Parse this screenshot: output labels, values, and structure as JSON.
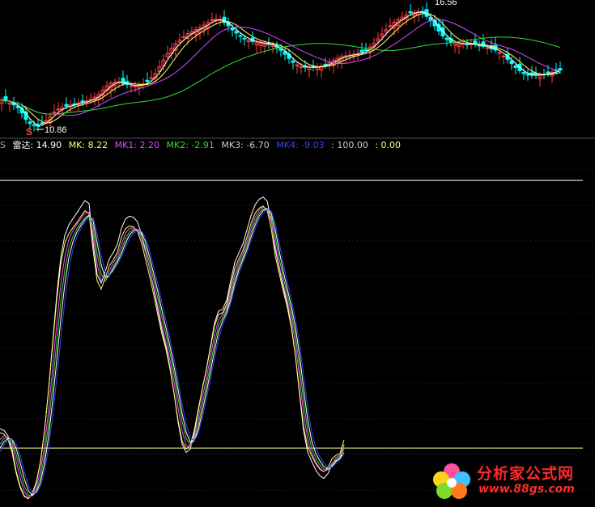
{
  "colors": {
    "background": "#000000",
    "candle_up": "#ff4040",
    "candle_down": "#00ffff",
    "ma_white": "#ffffff",
    "ma_yellow": "#ffff66",
    "ma_magenta": "#d24dff",
    "ma_green": "#33dd33",
    "osc_white": "#ffffff",
    "osc_yellow": "#ffff66",
    "osc_magenta": "#ff44ff",
    "osc_green": "#33dd33",
    "osc_blue": "#3344ff",
    "guide_line": "#ffffff",
    "low_guide": "#ffff88"
  },
  "price_panel": {
    "high_label": "16.56",
    "low_label": "10.86",
    "marker_icon": "S"
  },
  "indicator_legend": {
    "left_glyph": "S",
    "items": [
      {
        "label": "雷达: 14.90",
        "color": "#ffffff"
      },
      {
        "label": "MK: 8.22",
        "color": "#ffff66"
      },
      {
        "label": "MK1: 2.20",
        "color": "#d24dff"
      },
      {
        "label": "MK2: -2.91",
        "color": "#33dd33"
      },
      {
        "label": "MK3: -6.70",
        "color": "#cccccc"
      },
      {
        "label": "MK4: -9.03",
        "color": "#3344ff"
      },
      {
        "label": ": 100.00",
        "color": "#cccccc"
      },
      {
        "label": ": 0.00",
        "color": "#ffff88"
      }
    ]
  },
  "watermark": {
    "chinese": "分析家公式网",
    "url": "www.88gs.com"
  },
  "chart_data": [
    {
      "type": "candlestick",
      "title": "",
      "ylim": [
        10.5,
        16.8
      ],
      "x": [
        0,
        5,
        10,
        15,
        20,
        25,
        30,
        35,
        40,
        45,
        50,
        55,
        60,
        65,
        70,
        75,
        80,
        85,
        90,
        95,
        100,
        105,
        110,
        115,
        120,
        125,
        130,
        135,
        140,
        145,
        150,
        155,
        160,
        165,
        170,
        175,
        180,
        185,
        190,
        195,
        200,
        205,
        210,
        215,
        220,
        225,
        230,
        235,
        240,
        245,
        250,
        255,
        260,
        265,
        270,
        275,
        280,
        285,
        290,
        295,
        300,
        305,
        310,
        315,
        320,
        325,
        330,
        335,
        340,
        345,
        350,
        355,
        360,
        365,
        370,
        375,
        380,
        385,
        390,
        395,
        400,
        405,
        410,
        415,
        420,
        425,
        430,
        435,
        440,
        445,
        450,
        455,
        460,
        465,
        470,
        475,
        480,
        485,
        490,
        495,
        500,
        505,
        510,
        515,
        520,
        525,
        530,
        535,
        540,
        545,
        550,
        555,
        560,
        565,
        570,
        575,
        580,
        585,
        590,
        595,
        600,
        605,
        610,
        615,
        620,
        625,
        630,
        635,
        640,
        645,
        650,
        655,
        660,
        665,
        670,
        675,
        680,
        685,
        690,
        695,
        700,
        705,
        710,
        715,
        720
      ],
      "close": [
        12.19,
        12.14,
        12.05,
        11.95,
        11.82,
        11.58,
        11.27,
        11.08,
        11.0,
        10.94,
        11.09,
        11.22,
        11.42,
        11.62,
        11.76,
        11.82,
        11.89,
        11.95,
        11.99,
        12.05,
        12.08,
        12.14,
        12.21,
        12.32,
        12.45,
        12.65,
        12.84,
        12.97,
        13.03,
        13.03,
        12.97,
        12.91,
        12.85,
        12.84,
        12.88,
        12.94,
        13.05,
        13.23,
        13.43,
        13.74,
        14.06,
        14.37,
        14.62,
        14.82,
        15.0,
        15.15,
        15.3,
        15.39,
        15.49,
        15.58,
        15.7,
        15.82,
        15.95,
        15.97,
        15.94,
        15.82,
        15.66,
        15.47,
        15.32,
        15.2,
        15.06,
        14.98,
        14.93,
        14.89,
        14.86,
        14.82,
        14.79,
        14.75,
        14.65,
        14.51,
        14.33,
        14.13,
        13.95,
        13.83,
        13.75,
        13.72,
        13.71,
        13.72,
        13.74,
        13.78,
        13.84,
        13.93,
        14.05,
        14.14,
        14.22,
        14.26,
        14.29,
        14.33,
        14.37,
        14.43,
        14.53,
        14.67,
        14.85,
        15.06,
        15.28,
        15.48,
        15.67,
        15.83,
        15.95,
        16.07,
        16.18,
        16.27,
        16.3,
        16.34,
        16.29,
        16.11,
        15.9,
        15.66,
        15.42,
        15.19,
        15.02,
        14.91,
        14.86,
        14.83,
        14.83,
        14.81,
        14.81,
        14.79,
        14.74,
        14.7,
        14.64,
        14.58,
        14.52,
        14.4,
        14.25,
        14.09,
        13.89,
        13.71,
        13.56,
        13.42,
        13.35,
        13.34,
        13.35,
        13.37,
        13.39,
        13.44,
        13.49,
        13.55,
        13.59
      ]
    },
    {
      "type": "line",
      "title": "",
      "xlabel": "",
      "ylabel": "",
      "ylim": [
        -22,
        110
      ],
      "reference_lines": [
        100,
        0
      ],
      "x": [
        0,
        5,
        10,
        15,
        20,
        25,
        30,
        35,
        40,
        45,
        50,
        55,
        60,
        65,
        70,
        75,
        80,
        85,
        90,
        95,
        100,
        105,
        110,
        115,
        120,
        125,
        130,
        135,
        140,
        145,
        150,
        155,
        160,
        165,
        170,
        175,
        180,
        185,
        190,
        195,
        200,
        205,
        210,
        215,
        220,
        225,
        230,
        235,
        240,
        245,
        250,
        255,
        260,
        265,
        270,
        275,
        280,
        285,
        290,
        295,
        300,
        305,
        310,
        315,
        320,
        325,
        330,
        335,
        340,
        345,
        350,
        355,
        360,
        365,
        370,
        375,
        380,
        385,
        390,
        395,
        400,
        405,
        410,
        415,
        420,
        425,
        430,
        435,
        440,
        445,
        450,
        455,
        460,
        465,
        470,
        475,
        480,
        485,
        490,
        495,
        500,
        505,
        510,
        515,
        520,
        525,
        530,
        535,
        540,
        545,
        550,
        555,
        560,
        565,
        570,
        575,
        580,
        585,
        590,
        595,
        600,
        605,
        610,
        615,
        620,
        625,
        630,
        635,
        640,
        645,
        650,
        655,
        660,
        665,
        670,
        675,
        680,
        685,
        690,
        695,
        700,
        705,
        710,
        715,
        720
      ],
      "series": [
        {
          "name": "雷达",
          "values": [
            7.23,
            6.59,
            4.47,
            -0.62,
            -8.62,
            -14.33,
            -17.83,
            -18.91,
            -16.96,
            -12.77,
            -5.32,
            6.48,
            21.93,
            39.47,
            56.81,
            71.04,
            79.4,
            83.4,
            85.72,
            87.85,
            90.26,
            92.45,
            91.33,
            76.83,
            64.81,
            61.66,
            66.07,
            70.64,
            73.12,
            76.17,
            82.13,
            85.59,
            86.66,
            86.24,
            84.43,
            79.64,
            73.08,
            66.6,
            59.39,
            51.6,
            44.08,
            38.0,
            30.15,
            20.44,
            9.62,
            1.4,
            -1.62,
            -0.33,
            5.66,
            14.07,
            22.21,
            29.61,
            38.04,
            46.74,
            51.28,
            51.91,
            55.26,
            62.53,
            69.33,
            72.87,
            76.24,
            81.46,
            86.79,
            90.86,
            92.9,
            93.76,
            92.23,
            85.16,
            74.2,
            67.02,
            60.05,
            53.6,
            45.44,
            34.33,
            20.17,
            6.49,
            -1.47,
            -4.89,
            -8.15,
            -10.31,
            -11.34,
            -9.55,
            -6.24,
            -4.76,
            -4.05,
            1.31
          ]
        },
        {
          "name": "MK",
          "values": [
            5.8,
            5.2,
            3.2,
            -1.7,
            -9.4,
            -14.8,
            -18.1,
            -18.9,
            -16.8,
            -12.4,
            -5.0,
            6.7,
            21.6,
            38.6,
            55.2,
            68.6,
            76.5,
            80.1,
            82.3,
            84.3,
            86.6,
            88.7,
            87.6,
            73.9,
            62.5,
            59.4,
            63.6,
            68.0,
            70.3,
            73.2,
            78.8,
            82.0,
            83.0,
            82.6,
            80.9,
            76.4,
            70.2,
            64.0,
            57.1,
            49.7,
            42.6,
            36.9,
            29.5,
            20.4,
            10.3,
            2.6,
            -0.3,
            1.0,
            6.7,
            14.7,
            22.4,
            29.4,
            37.4,
            45.7,
            50.0,
            50.6,
            53.8,
            60.7,
            67.2,
            70.6,
            73.8,
            78.8,
            83.8,
            87.7,
            89.6,
            90.4,
            88.9,
            82.2,
            71.9,
            65.1,
            58.5,
            52.5,
            44.7,
            34.3,
            20.9,
            8.0,
            0.5,
            -2.8,
            -5.8,
            -7.9,
            -8.9,
            -7.2,
            -4.1,
            -2.7,
            -2.0,
            3.0
          ]
        },
        {
          "name": "MK1",
          "values": [
            3.2,
            4.6,
            3.9,
            1.2,
            -4.9,
            -11.2,
            -16.3,
            -18.4,
            -17.6,
            -14.3,
            -8.6,
            0.8,
            14.1,
            29.9,
            46.3,
            61.0,
            71.5,
            77.8,
            81.2,
            83.6,
            85.7,
            87.8,
            88.1,
            80.2,
            68.7,
            62.4,
            62.3,
            66.1,
            69.2,
            71.7,
            76.1,
            80.3,
            82.1,
            82.3,
            81.4,
            78.2,
            72.7,
            66.6,
            60.2,
            52.9,
            45.7,
            39.5,
            32.7,
            24.5,
            15.0,
            6.4,
            1.1,
            0.3,
            4.2,
            11.3,
            19.1,
            26.3,
            34.0,
            42.3,
            47.9,
            50.0,
            52.8,
            58.5,
            65.0,
            69.3,
            72.5,
            77.0,
            82.0,
            86.2,
            88.8,
            90.0,
            89.4,
            84.7,
            75.9,
            67.9,
            61.3,
            55.1,
            48.2,
            38.8,
            26.4,
            12.9,
            3.3,
            -1.9,
            -5.1,
            -7.4,
            -8.7,
            -8.1,
            -5.7,
            -3.6,
            -2.5,
            1.0
          ]
        },
        {
          "name": "MK2",
          "values": [
            1.5,
            3.6,
            4.0,
            2.5,
            -2.4,
            -8.5,
            -14.2,
            -17.5,
            -17.9,
            -15.6,
            -10.9,
            -2.7,
            9.0,
            23.7,
            39.4,
            54.5,
            66.6,
            74.5,
            79.0,
            81.9,
            84.1,
            86.1,
            87.1,
            82.7,
            72.6,
            65.0,
            62.5,
            64.7,
            67.8,
            70.4,
            74.1,
            78.3,
            80.8,
            81.8,
            81.6,
            79.4,
            74.8,
            68.9,
            62.7,
            55.9,
            48.7,
            42.3,
            35.5,
            27.7,
            18.8,
            10.0,
            3.6,
            1.2,
            3.1,
            8.9,
            16.3,
            23.6,
            31.2,
            39.4,
            45.7,
            48.8,
            51.7,
            56.9,
            63.3,
            67.9,
            71.3,
            75.5,
            80.4,
            84.7,
            87.7,
            89.3,
            89.5,
            86.3,
            78.8,
            70.6,
            63.6,
            57.3,
            50.7,
            42.1,
            30.7,
            17.7,
            6.7,
            0.0,
            -3.7,
            -6.2,
            -7.9,
            -8.1,
            -6.4,
            -4.3,
            -3.0,
            -0.4
          ]
        },
        {
          "name": "MK3",
          "values": [
            0.0,
            2.4,
            3.6,
            3.2,
            -0.1,
            -5.5,
            -11.4,
            -15.9,
            -17.6,
            -16.4,
            -12.8,
            -5.8,
            4.3,
            17.6,
            32.5,
            47.8,
            61.1,
            71.0,
            77.0,
            80.6,
            83.2,
            85.4,
            86.9,
            84.9,
            76.7,
            68.4,
            63.9,
            64.3,
            66.9,
            69.5,
            72.6,
            76.6,
            79.6,
            81.2,
            81.6,
            80.4,
            76.8,
            71.1,
            64.9,
            58.5,
            51.5,
            44.9,
            38.0,
            30.4,
            21.9,
            13.0,
            5.9,
            2.3,
            2.7,
            7.0,
            13.8,
            21.0,
            28.5,
            36.5,
            43.4,
            47.5,
            50.7,
            55.4,
            61.6,
            66.6,
            70.3,
            74.2,
            78.9,
            83.3,
            86.7,
            88.7,
            89.5,
            87.7,
            81.5,
            73.5,
            66.0,
            59.3,
            52.9,
            45.1,
            34.9,
            22.3,
            10.7,
            2.7,
            -1.9,
            -4.7,
            -6.9,
            -7.8,
            -6.9,
            -5.0,
            -3.6,
            -1.6
          ]
        },
        {
          "name": "MK4",
          "values": [
            -1.4,
            1.2,
            3.0,
            3.4,
            1.5,
            -2.9,
            -8.8,
            -14.0,
            -16.8,
            -16.8,
            -14.2,
            -8.6,
            0.1,
            11.9,
            25.8,
            40.7,
            54.7,
            66.4,
            74.2,
            78.9,
            82.0,
            84.5,
            86.3,
            86.0,
            80.1,
            71.9,
            66.1,
            64.4,
            66.2,
            68.7,
            71.4,
            75.0,
            78.3,
            80.3,
            81.2,
            80.9,
            78.4,
            73.6,
            67.4,
            61.1,
            54.4,
            47.7,
            40.7,
            33.3,
            25.1,
            16.4,
            8.9,
            4.0,
            2.8,
            5.6,
            11.5,
            18.5,
            25.9,
            33.7,
            40.9,
            46.0,
            49.6,
            54.0,
            59.9,
            65.1,
            69.1,
            72.9,
            77.4,
            81.8,
            85.4,
            87.8,
            89.2,
            88.7,
            84.0,
            76.6,
            68.9,
            61.9,
            55.4,
            48.0,
            38.9,
            27.3,
            15.4,
            5.9,
            0.3,
            -3.2,
            -5.6,
            -7.1,
            -7.2,
            -5.7,
            -4.2,
            -2.6
          ]
        }
      ]
    }
  ]
}
